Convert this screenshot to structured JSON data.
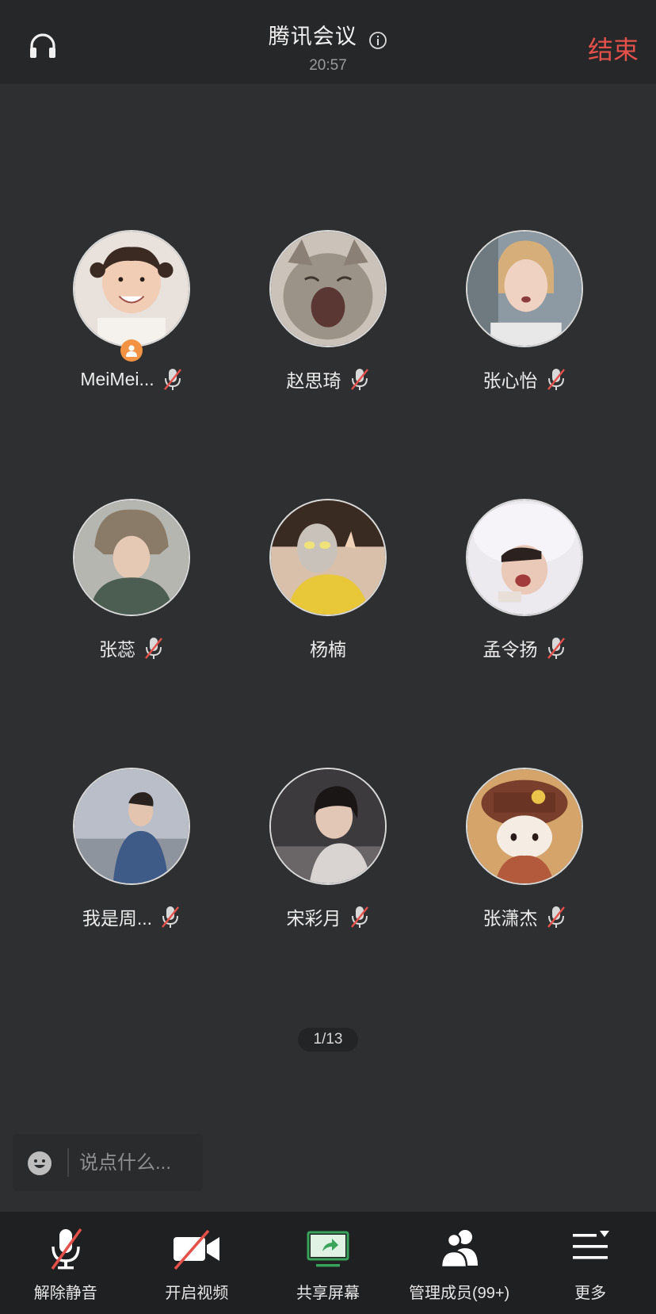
{
  "header": {
    "title": "腾讯会议",
    "time": "20:57",
    "end_label": "结束"
  },
  "participants": [
    {
      "name": "MeiMei...",
      "muted": true,
      "host": true
    },
    {
      "name": "赵思琦",
      "muted": true,
      "host": false
    },
    {
      "name": "张心怡",
      "muted": true,
      "host": false
    },
    {
      "name": "张蕊",
      "muted": true,
      "host": false
    },
    {
      "name": "杨楠",
      "muted": false,
      "host": false
    },
    {
      "name": "孟令扬",
      "muted": true,
      "host": false
    },
    {
      "name": "我是周...",
      "muted": true,
      "host": false
    },
    {
      "name": "宋彩月",
      "muted": true,
      "host": false
    },
    {
      "name": "张潇杰",
      "muted": true,
      "host": false
    }
  ],
  "pager": {
    "text": "1/13"
  },
  "chat": {
    "placeholder": "说点什么..."
  },
  "toolbar": [
    {
      "label": "解除静音",
      "icon": "mic-muted-icon"
    },
    {
      "label": "开启视频",
      "icon": "camera-off-icon"
    },
    {
      "label": "共享屏幕",
      "icon": "share-screen-icon"
    },
    {
      "label": "管理成员(99+)",
      "icon": "members-icon"
    },
    {
      "label": "更多",
      "icon": "more-icon"
    }
  ],
  "colors": {
    "background": "#2e2f31",
    "end_red": "#e4504a",
    "share_green": "#3aa35b",
    "mute_red": "#e4504a",
    "host_badge": "#f19342"
  }
}
